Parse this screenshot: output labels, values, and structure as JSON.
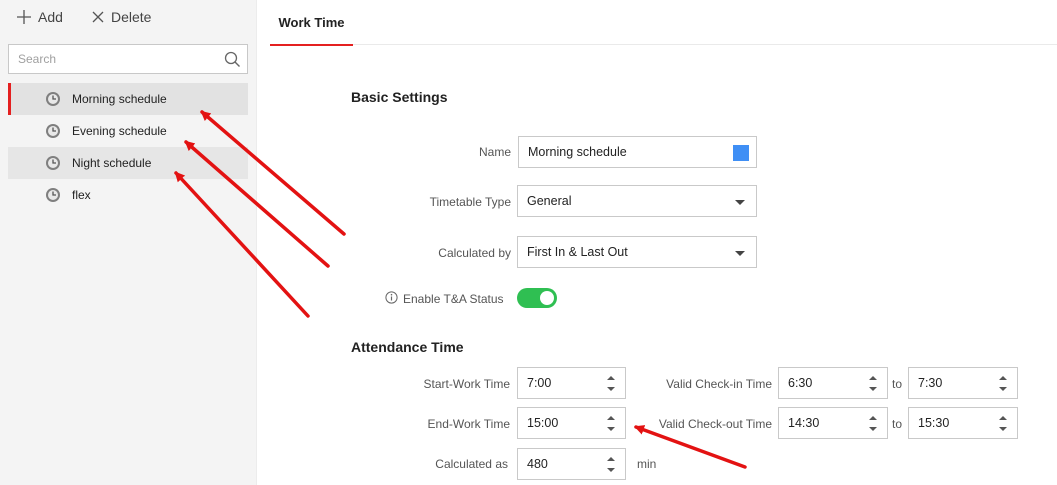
{
  "toolbar": {
    "add_label": "Add",
    "delete_label": "Delete"
  },
  "search": {
    "placeholder": "Search"
  },
  "schedules": [
    {
      "label": "Morning schedule"
    },
    {
      "label": "Evening schedule"
    },
    {
      "label": "Night schedule"
    },
    {
      "label": "flex"
    }
  ],
  "tabs": [
    {
      "label": "Work Time"
    }
  ],
  "basic": {
    "title": "Basic Settings",
    "name_label": "Name",
    "name_value": "Morning schedule",
    "name_color": "#3f8ff5",
    "type_label": "Timetable Type",
    "type_value": "General",
    "calc_label": "Calculated by",
    "calc_value": "First In & Last Out",
    "ta_label": "Enable T&A Status",
    "ta_enabled": true
  },
  "attendance": {
    "title": "Attendance Time",
    "start_label": "Start-Work Time",
    "start_value": "7:00",
    "end_label": "End-Work Time",
    "end_value": "15:00",
    "calc_as_label": "Calculated as",
    "calc_as_value": "480",
    "calc_as_unit": "min",
    "checkin_label": "Valid Check-in Time",
    "checkin_from": "6:30",
    "checkin_to": "7:30",
    "checkout_label": "Valid Check-out Time",
    "checkout_from": "14:30",
    "checkout_to": "15:30",
    "to_label": "to"
  },
  "colors": {
    "accent": "#e42020",
    "toggle_on": "#2fbf52",
    "annotation_arrow": "#e31212"
  }
}
